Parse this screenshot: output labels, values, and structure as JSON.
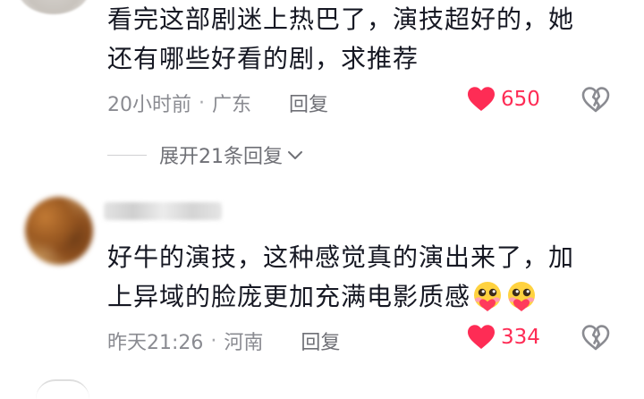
{
  "comments": [
    {
      "text_line1": "看完这部剧迷上热巴了，演技超好的，她",
      "text_line2": "还有哪些好看的剧，求推荐",
      "time": "20小时前",
      "separator": "·",
      "location": "广东",
      "reply_label": "回复",
      "likes": "650"
    },
    {
      "text_line1": "好牛的演技，这种感觉真的演出来了，加",
      "text_line2": "上异域的脸庞更加充满电影质感",
      "time": "昨天21:26",
      "separator": "·",
      "location": "河南",
      "reply_label": "回复",
      "likes": "334"
    }
  ],
  "expand_replies": {
    "label": "展开21条回复"
  },
  "icons": {
    "like": "heart-icon",
    "dislike": "broken-heart-icon",
    "expand": "chevron-down-icon",
    "emoji": "heart-eyes-emoji-icon"
  },
  "colors": {
    "like_red": "#fe2c55",
    "meta_gray": "#8a8b91",
    "text_dark": "#161823"
  }
}
